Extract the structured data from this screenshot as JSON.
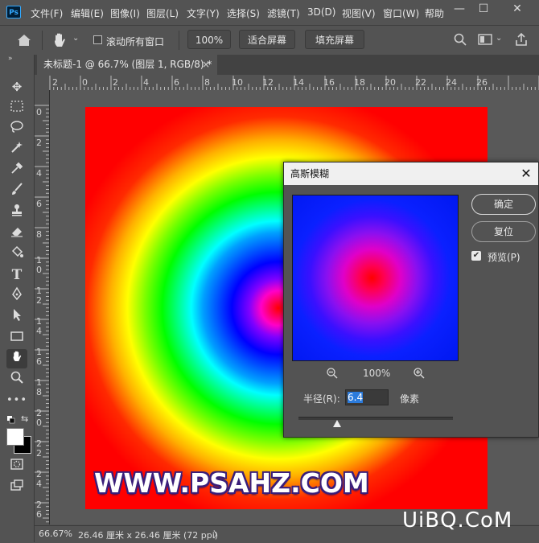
{
  "app": {
    "logo": "Ps"
  },
  "menu": [
    {
      "label": "文件(F)"
    },
    {
      "label": "编辑(E)"
    },
    {
      "label": "图像(I)"
    },
    {
      "label": "图层(L)"
    },
    {
      "label": "文字(Y)"
    },
    {
      "label": "选择(S)"
    },
    {
      "label": "滤镜(T)"
    },
    {
      "label": "3D(D)"
    },
    {
      "label": "视图(V)"
    },
    {
      "label": "窗口(W)"
    },
    {
      "label": "帮助"
    }
  ],
  "window_controls": {
    "minimize": "—",
    "maximize": "☐",
    "close": "✕"
  },
  "options_bar": {
    "scroll_all_windows": "滚动所有窗口",
    "zoom_100": "100%",
    "fit_screen": "适合屏幕",
    "fill_screen": "填充屏幕"
  },
  "document": {
    "tab_title": "未标题-1 @ 66.7% (图层 1, RGB/8) *",
    "tab_close": "×"
  },
  "ruler_top": [
    "2",
    "0",
    "2",
    "4",
    "6",
    "8",
    "10",
    "12",
    "14",
    "16",
    "18",
    "20",
    "22",
    "24",
    "26"
  ],
  "ruler_left": [
    "0",
    "2",
    "4",
    "6",
    "8",
    "1\n0",
    "1\n2",
    "1\n4",
    "1\n6",
    "1\n8",
    "2\n0",
    "2\n2",
    "2\n4",
    "2\n6"
  ],
  "canvas": {
    "watermark": "WWW.PSAHZ.COM"
  },
  "status": {
    "zoom": "66.67%",
    "info": "26.46 厘米 x 26.46 厘米 (72 ppi)",
    "arrow": "〉"
  },
  "corner_brand": "UiBQ.CoM",
  "dialog": {
    "title": "高斯模糊",
    "ok": "确定",
    "reset": "复位",
    "preview_label": "预览(P)",
    "preview_checked": true,
    "zoom_level": "100%",
    "radius_label": "半径(R):",
    "radius_value": "6.4",
    "radius_unit": "像素",
    "radius_slider_fraction": 0.25
  },
  "colors": {
    "ui_bg": "#535353",
    "workspace": "#595959",
    "accent_blue": "#2b7bdc",
    "watermark_outline": "#3a1e7a"
  }
}
